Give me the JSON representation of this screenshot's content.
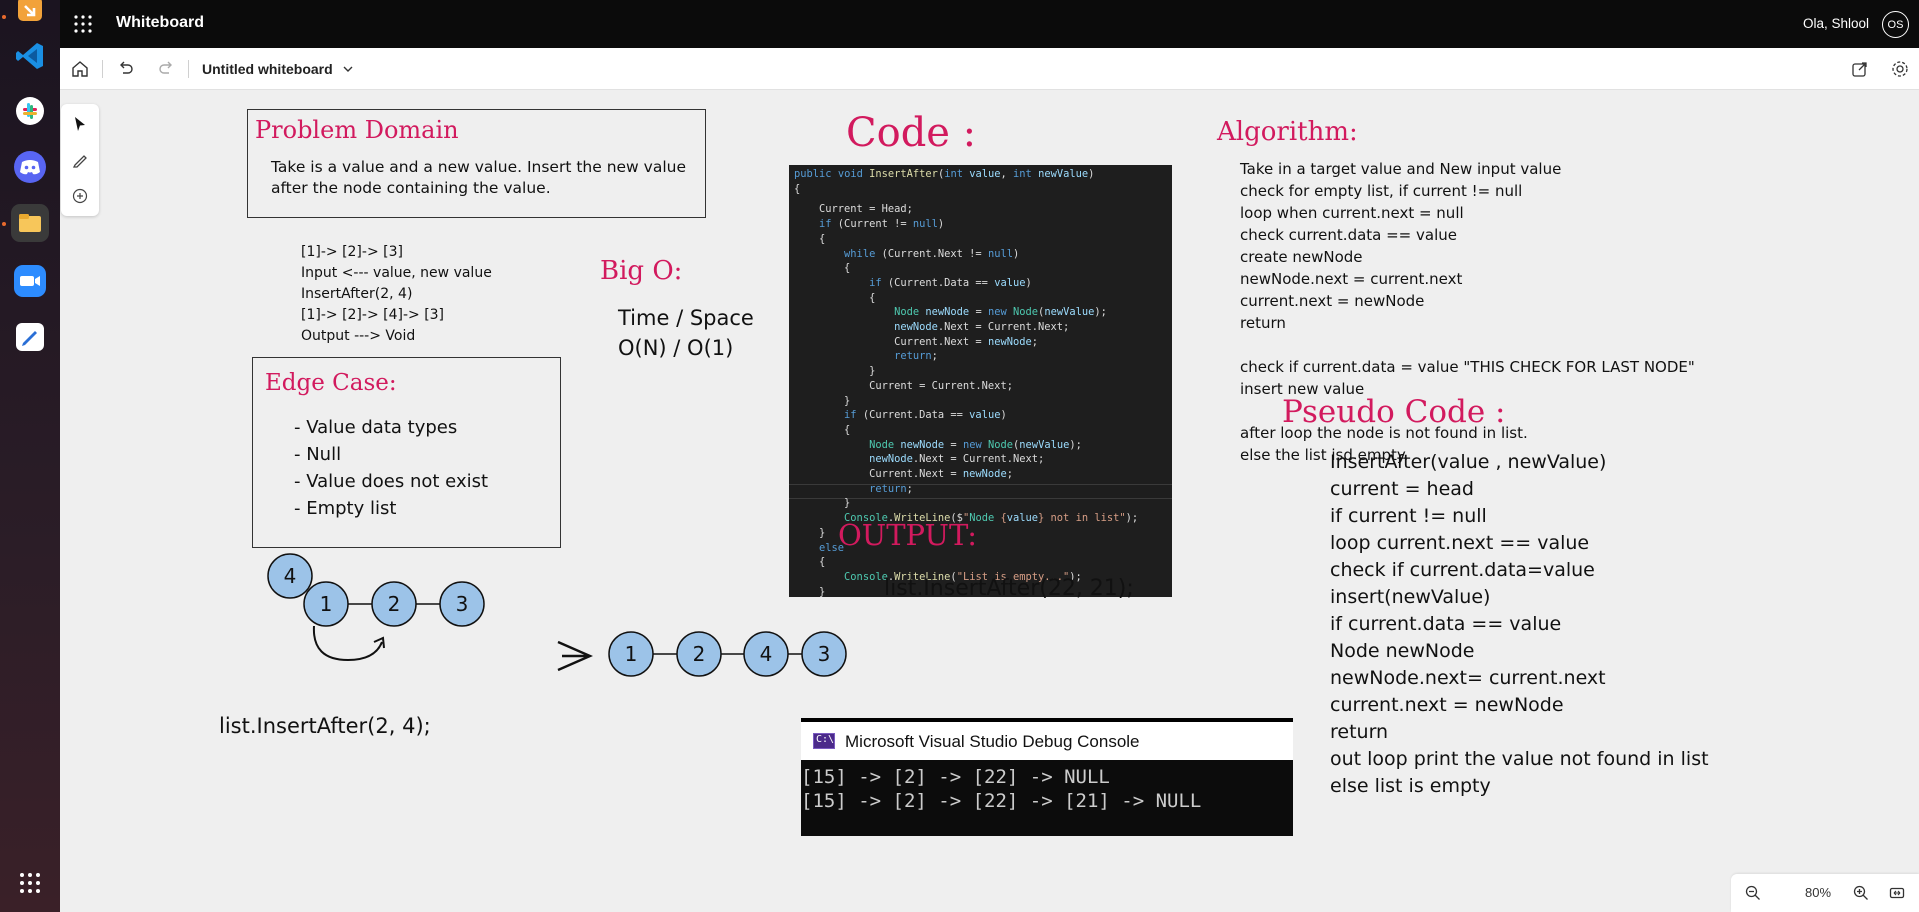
{
  "app": {
    "title": "Whiteboard",
    "user_name": "Ola, Shlool",
    "user_initials": "OS"
  },
  "command_bar": {
    "document_title": "Untitled whiteboard"
  },
  "zoom": {
    "level": "80%"
  },
  "taskbar": {
    "apps": [
      "download-app-icon",
      "vscode-icon",
      "slack-icon",
      "discord-icon",
      "file-explorer-icon",
      "zoom-app-icon",
      "whiteboard-app-icon",
      "app-grid-icon"
    ]
  },
  "board": {
    "problem_domain": {
      "title": "Problem Domain",
      "line1": "Take is a value and a new value. Insert the new value",
      "line2": "after the node containing the value."
    },
    "example": {
      "line1": "[1]-> [2]-> [3]",
      "line2": "Input <--- value, new value",
      "line3": "InsertAfter(2, 4)",
      "line4": "[1]-> [2]-> [4]-> [3]",
      "line5": "Output ---> Void"
    },
    "edge_case": {
      "title": "Edge Case:",
      "items": [
        "- Value data types",
        "- Null",
        "- Value does not exist",
        "- Empty list"
      ]
    },
    "big_o": {
      "title": "Big O:",
      "line1": "Time / Space",
      "line2": "O(N) / O(1)"
    },
    "code": {
      "title": "Code :",
      "lines": [
        "public void InsertAfter(int value, int newValue)",
        "{",
        "    Current = Head;",
        "    if (Current != null)",
        "    {",
        "        while (Current.Next != null)",
        "        {",
        "            if (Current.Data == value)",
        "            {",
        "                Node newNode = new Node(newValue);",
        "                newNode.Next = Current.Next;",
        "                Current.Next = newNode;",
        "                return;",
        "            }",
        "            Current = Current.Next;",
        "        }",
        "        if (Current.Data == value)",
        "        {",
        "            Node newNode = new Node(newValue);",
        "            newNode.Next = Current.Next;",
        "            Current.Next = newNode;",
        "            return;",
        "        }",
        "        Console.WriteLine($\"Node {value} not in list\");",
        "    }",
        "    else",
        "    {",
        "        Console.WriteLine(\"List is empty...\");",
        "    }"
      ]
    },
    "algorithm": {
      "title": "Algorithm:",
      "lines": [
        "Take in a target value and New input value",
        "check for empty list, if current != null",
        "loop when current.next = null",
        "check current.data == value",
        "create newNode",
        "newNode.next = current.next",
        "current.next = newNode",
        "return",
        "",
        "check if current.data = value \"THIS CHECK FOR LAST NODE\"",
        "insert new value",
        "",
        "after loop the node is not found in list.",
        "else the list isd empty."
      ]
    },
    "pseudo_code": {
      "title": "Pseudo Code :",
      "lines": [
        "InsertAfter(value , newValue)",
        "current = head",
        "if current != null",
        "loop current.next == value",
        "check if current.data=value",
        "insert(newValue)",
        "if current.data == value",
        "Node newNode",
        "newNode.next= current.next",
        "current.next = newNode",
        "return",
        "out loop print the value not found in list",
        "else list is empty"
      ]
    },
    "output": {
      "title": "OUTPUT:",
      "call": "list.InsertAfter(22, 21);",
      "console_title": "Microsoft Visual Studio Debug Console",
      "console_line1": "[15] -> [2] -> [22] -> NULL",
      "console_line2": "[15] -> [2] -> [22] -> [21] -> NULL"
    },
    "diagram": {
      "new_node": "4",
      "before": [
        "1",
        "2",
        "3"
      ],
      "after": [
        "1",
        "2",
        "4",
        "3"
      ],
      "call": "list.InsertAfter(2, 4);"
    }
  }
}
